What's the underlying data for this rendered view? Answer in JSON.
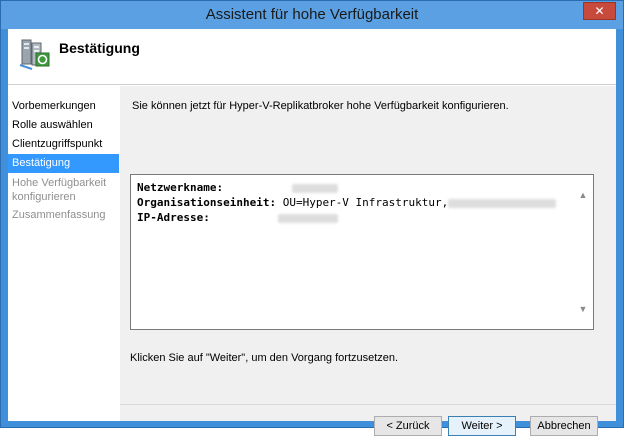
{
  "window": {
    "title": "Assistent für hohe Verfügbarkeit",
    "close_label": "✕"
  },
  "header": {
    "title": "Bestätigung"
  },
  "nav": {
    "items": [
      {
        "label": "Vorbemerkungen"
      },
      {
        "label": "Rolle auswählen"
      },
      {
        "label": "Clientzugriffspunkt"
      },
      {
        "label": "Bestätigung"
      },
      {
        "label": "Hohe Verfügbarkeit konfigurieren"
      },
      {
        "label": "Zusammenfassung"
      }
    ]
  },
  "content": {
    "intro": "Sie können jetzt für Hyper-V-Replikatbroker hohe Verfügbarkeit konfigurieren.",
    "details": {
      "network_label": "Netzwerkname:",
      "ou_label": "Organisationseinheit:",
      "ou_value": "OU=Hyper-V Infrastruktur,",
      "ip_label": "IP-Adresse:"
    },
    "hint": "Klicken Sie auf \"Weiter\", um den Vorgang fortzusetzen."
  },
  "buttons": {
    "back": "< Zurück",
    "next": "Weiter >",
    "cancel": "Abbrechen"
  },
  "colors": {
    "accent": "#3399ff",
    "window_frame": "#3f8fdb",
    "close": "#c74a3c"
  }
}
